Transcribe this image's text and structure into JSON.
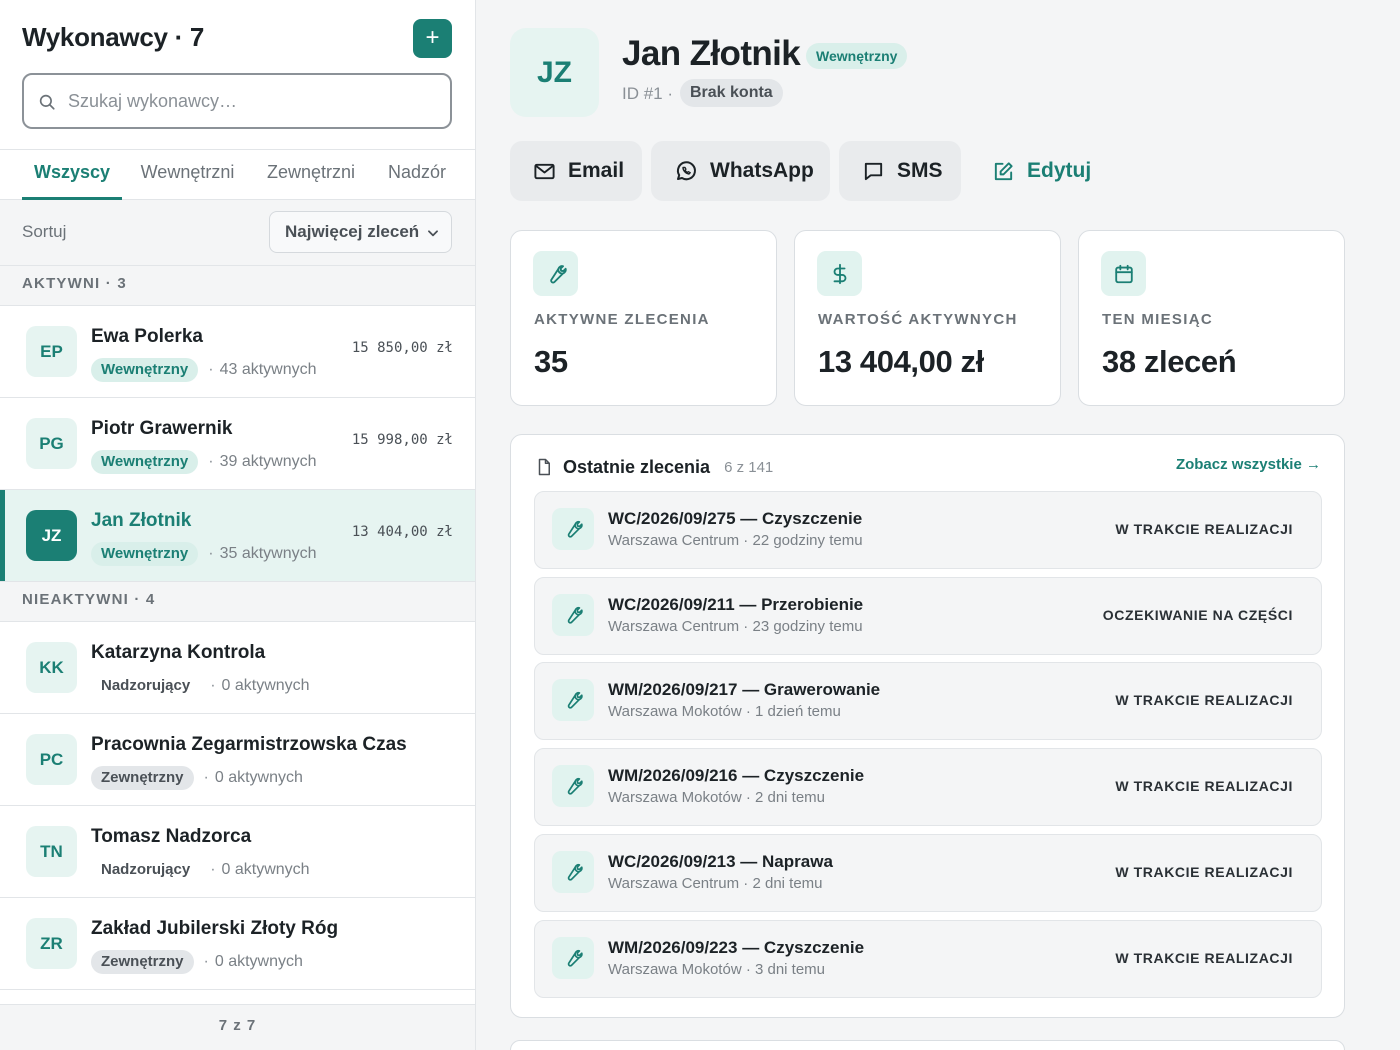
{
  "sidebar": {
    "title": "Wykonawcy · 7",
    "add_label": "+",
    "search": {
      "placeholder": "Szukaj wykonawcy…",
      "value": ""
    },
    "tabs": [
      {
        "label": "Wszyscy",
        "active": true
      },
      {
        "label": "Wewnętrzni",
        "active": false
      },
      {
        "label": "Zewnętrzni",
        "active": false
      },
      {
        "label": "Nadzór",
        "active": false
      }
    ],
    "sort": {
      "label": "Sortuj",
      "selected": "Najwięcej zleceń"
    },
    "groups": [
      {
        "label": "AKTYWNI  · 3",
        "people": [
          {
            "initials": "EP",
            "name": "Ewa Polerka",
            "type": "Wewnętrzny",
            "type_kind": "internal",
            "dot": "·",
            "count": "43 aktywnych",
            "value": "15 850,00 zł",
            "selected": false
          },
          {
            "initials": "PG",
            "name": "Piotr Grawernik",
            "type": "Wewnętrzny",
            "type_kind": "internal",
            "dot": "·",
            "count": "39 aktywnych",
            "value": "15 998,00 zł",
            "selected": false
          },
          {
            "initials": "JZ",
            "name": "Jan Złotnik",
            "type": "Wewnętrzny",
            "type_kind": "internal",
            "dot": "·",
            "count": "35 aktywnych",
            "value": "13 404,00 zł",
            "selected": true
          }
        ]
      },
      {
        "label": "NIEAKTYWNI  · 4",
        "people": [
          {
            "initials": "KK",
            "name": "Katarzyna Kontrola",
            "type": "Nadzorujący",
            "type_kind": "supervisor",
            "dot": "·",
            "count": "0 aktywnych",
            "value": "",
            "selected": false
          },
          {
            "initials": "PC",
            "name": "Pracownia Zegarmistrzowska Czas",
            "type": "Zewnętrzny",
            "type_kind": "external",
            "dot": "·",
            "count": "0 aktywnych",
            "value": "",
            "selected": false
          },
          {
            "initials": "TN",
            "name": "Tomasz Nadzorca",
            "type": "Nadzorujący",
            "type_kind": "supervisor",
            "dot": "·",
            "count": "0 aktywnych",
            "value": "",
            "selected": false
          },
          {
            "initials": "ZR",
            "name": "Zakład Jubilerski Złoty Róg",
            "type": "Zewnętrzny",
            "type_kind": "external",
            "dot": "·",
            "count": "0 aktywnych",
            "value": "",
            "selected": false
          }
        ]
      }
    ],
    "footer": "7 z 7"
  },
  "detail": {
    "initials": "JZ",
    "name": "Jan Złotnik",
    "type_badge": "Wewnętrzny",
    "id_text": "ID #1 ·",
    "account_badge": "Brak konta",
    "actions": [
      {
        "label": "Email",
        "icon": "mail-icon"
      },
      {
        "label": "WhatsApp",
        "icon": "whatsapp-icon"
      },
      {
        "label": "SMS",
        "icon": "message-icon"
      },
      {
        "label": "Edytuj",
        "icon": "edit-icon"
      }
    ],
    "stats": [
      {
        "icon": "wrench-icon",
        "label": "AKTYWNE ZLECENIA",
        "value": "35"
      },
      {
        "icon": "dollar-icon",
        "label": "WARTOŚĆ AKTYWNYCH",
        "value": "13 404,00 zł"
      },
      {
        "icon": "calendar-icon",
        "label": "TEN MIESIĄC",
        "value": "38 zleceń"
      }
    ],
    "orders": {
      "title": "Ostatnie zlecenia",
      "count": "6 z 141",
      "see_all": "Zobacz wszystkie →",
      "items": [
        {
          "title": "WC/2026/09/275 — Czyszczenie",
          "subtitle": "Warszawa Centrum · 22 godziny temu",
          "status": "W TRAKCIE REALIZACJI"
        },
        {
          "title": "WC/2026/09/211 — Przerobienie",
          "subtitle": "Warszawa Centrum · 23 godziny temu",
          "status": "OCZEKIWANIE NA CZĘŚCI"
        },
        {
          "title": "WM/2026/09/217 — Grawerowanie",
          "subtitle": "Warszawa Mokotów · 1 dzień temu",
          "status": "W TRAKCIE REALIZACJI"
        },
        {
          "title": "WM/2026/09/216 — Czyszczenie",
          "subtitle": "Warszawa Mokotów · 2 dni temu",
          "status": "W TRAKCIE REALIZACJI"
        },
        {
          "title": "WC/2026/09/213 — Naprawa",
          "subtitle": "Warszawa Centrum · 2 dni temu",
          "status": "W TRAKCIE REALIZACJI"
        },
        {
          "title": "WM/2026/09/223 — Czyszczenie",
          "subtitle": "Warszawa Mokotów · 3 dni temu",
          "status": "W TRAKCIE REALIZACJI"
        }
      ]
    }
  },
  "colors": {
    "accent": "#1b7f74",
    "accent_light": "#e6f4f1",
    "background": "#f4f5f6",
    "border": "#e2e5e8"
  }
}
